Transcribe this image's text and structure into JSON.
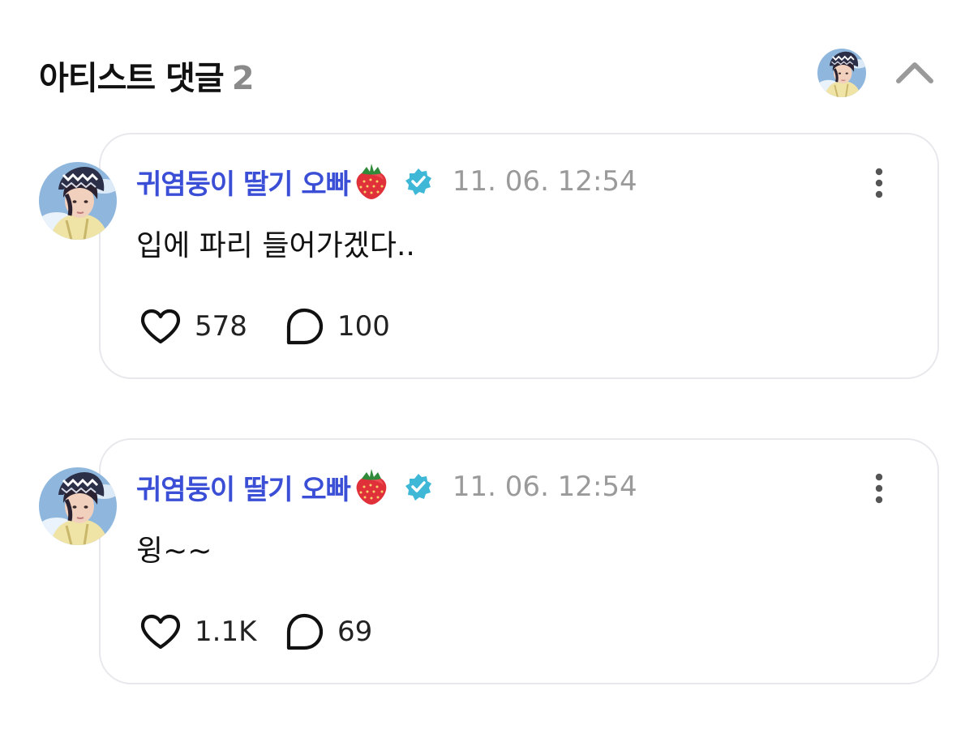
{
  "header": {
    "title": "아티스트 댓글",
    "count": "2"
  },
  "icons": {
    "collapse": "chevron-up-icon",
    "verified": "verified-badge-icon",
    "name_emoji": "strawberry-icon",
    "more": "more-vertical-icon",
    "like": "heart-icon",
    "reply": "speech-bubble-icon"
  },
  "colors": {
    "author_name": "#3a4ed6",
    "verified_badge": "#3fb8d8",
    "timestamp": "#9a9a9a",
    "card_border": "#e8e8ec"
  },
  "comments": [
    {
      "author": "귀염둥이 딸기 오빠",
      "timestamp": "11. 06. 12:54",
      "text": "입에 파리 들어가겠다..",
      "likes": "578",
      "replies": "100"
    },
    {
      "author": "귀염둥이 딸기 오빠",
      "timestamp": "11. 06. 12:54",
      "text": "윙~~",
      "likes": "1.1K",
      "replies": "69"
    }
  ]
}
